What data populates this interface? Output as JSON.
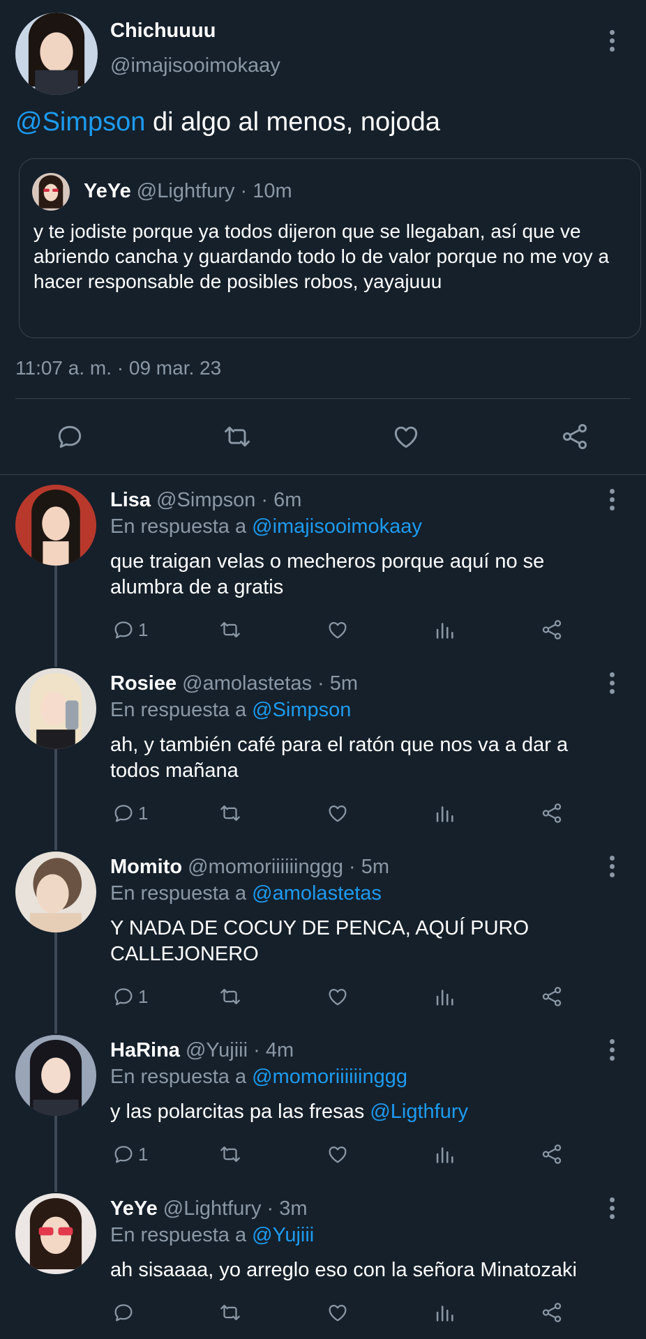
{
  "main_tweet": {
    "name": "Chichuuuu",
    "handle": "@imajisooimokaay",
    "text_mention": "@Simpson",
    "text_body": " di algo al menos, nojoda",
    "quote": {
      "name": "YeYe",
      "meta": " @Lightfury · 10m",
      "text": "y te jodiste porque ya todos dijeron que se llegaban, así que ve abriendo cancha y guardando todo lo de valor porque no me voy a hacer responsable de posibles robos, yayajuuu"
    },
    "timestamp": "11:07 a. m. · 09 mar. 23"
  },
  "replies": [
    {
      "name": "Lisa",
      "meta": " @Simpson · 6m",
      "in_reply_prefix": "En respuesta a ",
      "in_reply_to": "@imajisooimokaay",
      "text": "que traigan velas o mecheros porque aquí no se alumbra de a gratis",
      "reply_count": "1"
    },
    {
      "name": "Rosiee",
      "meta": " @amolastetas · 5m",
      "in_reply_prefix": "En respuesta a ",
      "in_reply_to": "@Simpson",
      "text": "ah, y también café para el ratón que nos va a dar a todos mañana",
      "reply_count": "1"
    },
    {
      "name": "Momito",
      "meta": " @momoriiiiiinggg · 5m",
      "in_reply_prefix": "En respuesta a ",
      "in_reply_to": "@amolastetas",
      "text": "Y NADA DE COCUY DE PENCA, AQUÍ PURO CALLEJONERO",
      "reply_count": "1"
    },
    {
      "name": "HaRina",
      "meta": " @Yujiii · 4m",
      "in_reply_prefix": "En respuesta a ",
      "in_reply_to": "@momoriiiiiinggg",
      "text": "y las polarcitas pa las fresas ",
      "text_mention": "@Ligthfury",
      "reply_count": "1"
    },
    {
      "name": "YeYe",
      "meta": " @Lightfury · 3m",
      "in_reply_prefix": "En respuesta a ",
      "in_reply_to": "@Yujiii",
      "text": "ah sisaaaa, yo arreglo eso con la señora Minatozaki",
      "reply_count": ""
    }
  ],
  "colors": {
    "background": "#15202b",
    "accent": "#1d9bf0",
    "muted": "#8b98a5",
    "divider": "#38444d"
  },
  "icons": [
    "reply-icon",
    "retweet-icon",
    "like-icon",
    "share-icon",
    "views-icon",
    "more-icon"
  ]
}
